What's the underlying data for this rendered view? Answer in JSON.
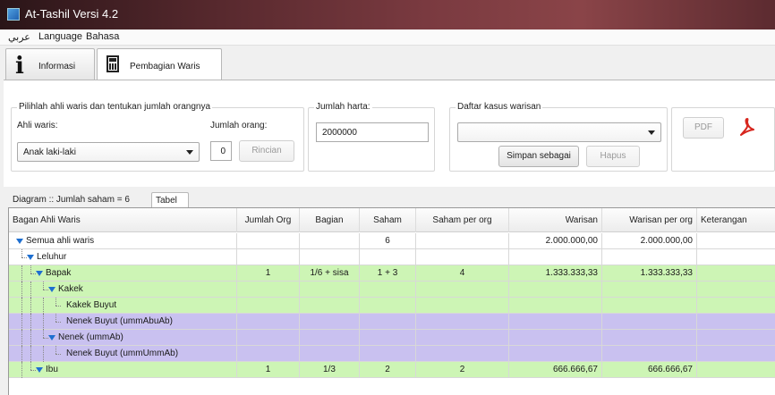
{
  "window": {
    "title": "At-Tashil Versi 4.2",
    "icon": "app-icon"
  },
  "menu": {
    "items": [
      "عربي",
      "Language",
      "Bahasa"
    ]
  },
  "tabs": [
    {
      "label": "Informasi",
      "icon": "info-icon"
    },
    {
      "label": "Pembagian Waris",
      "icon": "calculator-icon",
      "active": true
    }
  ],
  "form": {
    "heir_group_legend": "Pilihlah ahli waris dan tentukan jumlah orangnya",
    "heir_label": "Ahli waris:",
    "heir_selected": "Anak laki-laki",
    "count_label": "Jumlah orang:",
    "count_value": "0",
    "detail_button": "Rincian",
    "estate_legend": "Jumlah harta:",
    "estate_value": "2000000",
    "cases_legend": "Daftar kasus warisan",
    "cases_selected": "",
    "save_button": "Simpan sebagai",
    "delete_button": "Hapus",
    "pdf_button": "PDF"
  },
  "subtabs": [
    {
      "label": "Diagram :: Jumlah saham = 6"
    },
    {
      "label": "Tabel",
      "active": true
    }
  ],
  "table": {
    "columns": [
      "Bagan Ahli Waris",
      "Jumlah Org",
      "Bagian",
      "Saham",
      "Saham per org",
      "Warisan",
      "Warisan per org",
      "Keterangan"
    ],
    "rows": [
      {
        "name": "Semua ahli waris",
        "level": 0,
        "expand": true,
        "jumlah": "",
        "bagian": "",
        "saham": "6",
        "saham_per": "",
        "warisan": "2.000.000,00",
        "warisan_per": "2.000.000,00",
        "ket": "",
        "bg": "#ffffff"
      },
      {
        "name": "Leluhur",
        "level": 1,
        "expand": true,
        "jumlah": "",
        "bagian": "",
        "saham": "",
        "saham_per": "",
        "warisan": "",
        "warisan_per": "",
        "ket": "",
        "bg": "#ffffff"
      },
      {
        "name": "Bapak",
        "level": 2,
        "expand": true,
        "jumlah": "1",
        "bagian": "1/6 + sisa",
        "saham": "1 + 3",
        "saham_per": "4",
        "warisan": "1.333.333,33",
        "warisan_per": "1.333.333,33",
        "ket": "",
        "bg": "#cdf5b5"
      },
      {
        "name": "Kakek",
        "level": 3,
        "expand": true,
        "jumlah": "",
        "bagian": "",
        "saham": "",
        "saham_per": "",
        "warisan": "",
        "warisan_per": "",
        "ket": "",
        "bg": "#cdf5b5"
      },
      {
        "name": "Kakek Buyut",
        "level": 4,
        "expand": false,
        "jumlah": "",
        "bagian": "",
        "saham": "",
        "saham_per": "",
        "warisan": "",
        "warisan_per": "",
        "ket": "",
        "bg": "#cdf5b5"
      },
      {
        "name": "Nenek Buyut (ummAbuAb)",
        "level": 4,
        "expand": false,
        "jumlah": "",
        "bagian": "",
        "saham": "",
        "saham_per": "",
        "warisan": "",
        "warisan_per": "",
        "ket": "",
        "bg": "#c9c1f0"
      },
      {
        "name": "Nenek (ummAb)",
        "level": 3,
        "expand": true,
        "jumlah": "",
        "bagian": "",
        "saham": "",
        "saham_per": "",
        "warisan": "",
        "warisan_per": "",
        "ket": "",
        "bg": "#c9c1f0"
      },
      {
        "name": "Nenek Buyut (ummUmmAb)",
        "level": 4,
        "expand": false,
        "jumlah": "",
        "bagian": "",
        "saham": "",
        "saham_per": "",
        "warisan": "",
        "warisan_per": "",
        "ket": "",
        "bg": "#c9c1f0"
      },
      {
        "name": "Ibu",
        "level": 2,
        "expand": true,
        "jumlah": "1",
        "bagian": "1/3",
        "saham": "2",
        "saham_per": "2",
        "warisan": "666.666,67",
        "warisan_per": "666.666,67",
        "ket": "",
        "bg": "#cdf5b5"
      }
    ]
  }
}
